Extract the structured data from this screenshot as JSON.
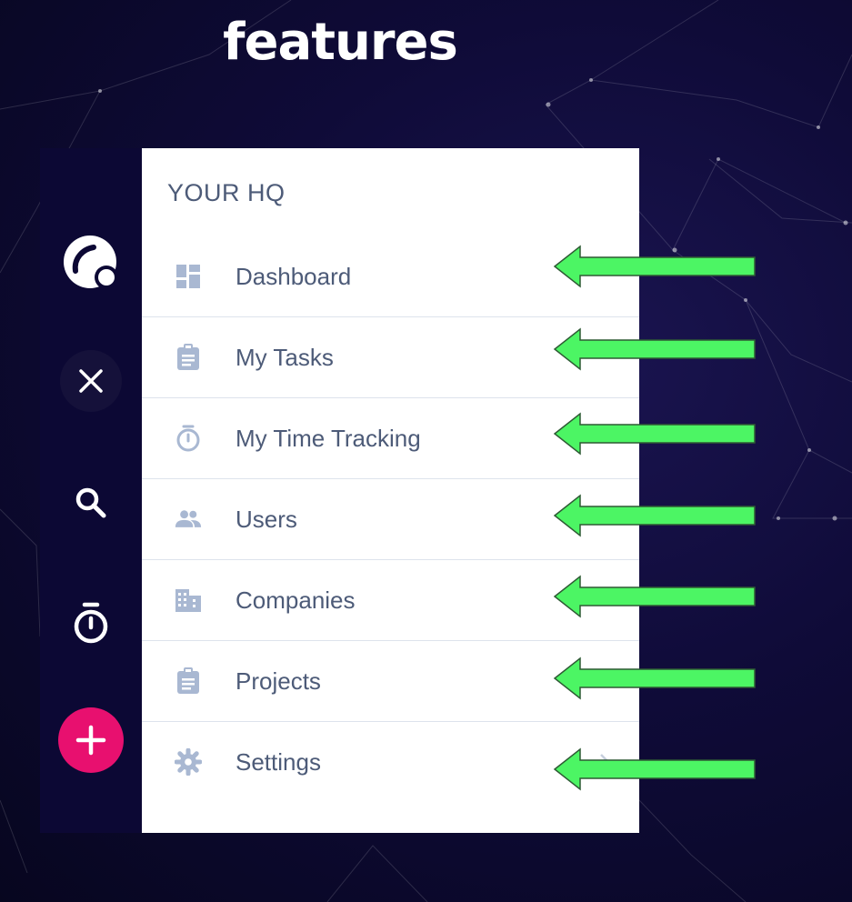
{
  "heading": "features",
  "rail": {
    "logo_icon": "brand-logo-icon",
    "close_icon": "close-icon",
    "search_icon": "search-icon",
    "timer_icon": "stopwatch-icon",
    "add_icon": "plus-icon",
    "add_color": "#e8106f"
  },
  "panel": {
    "title": "YOUR HQ",
    "items": [
      {
        "label": "Dashboard",
        "icon": "dashboard-icon"
      },
      {
        "label": "My Tasks",
        "icon": "clipboard-icon"
      },
      {
        "label": "My Time Tracking",
        "icon": "stopwatch-icon"
      },
      {
        "label": "Users",
        "icon": "users-icon"
      },
      {
        "label": "Companies",
        "icon": "building-icon"
      },
      {
        "label": "Projects",
        "icon": "clipboard-icon"
      },
      {
        "label": "Settings",
        "icon": "gear-icon"
      }
    ]
  },
  "colors": {
    "rail_bg": "#0c0834",
    "text": "#4d5b78",
    "icon": "#a9b8d2",
    "arrow": "#4cf564"
  }
}
